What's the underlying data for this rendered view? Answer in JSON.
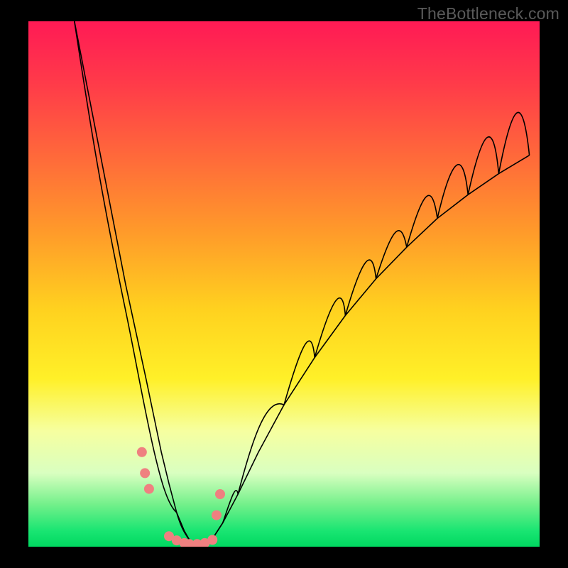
{
  "watermark": "TheBottleneck.com",
  "chart_data": {
    "type": "line",
    "title": "",
    "xlabel": "",
    "ylabel": "",
    "xlim": [
      0,
      100
    ],
    "ylim": [
      0,
      100
    ],
    "grid": false,
    "series": [
      {
        "name": "bottleneck-curve",
        "x": [
          9,
          11,
          13,
          15,
          17,
          19,
          21,
          23,
          24.5,
          26,
          27.5,
          29,
          30.5,
          31.5,
          33,
          34.5,
          36,
          38,
          41,
          45,
          50,
          56,
          62,
          68,
          74,
          80,
          86,
          92,
          98
        ],
        "values": [
          100,
          90,
          80,
          70,
          60,
          50,
          41,
          32,
          25,
          18,
          12,
          6.5,
          3,
          1.3,
          0.5,
          0.5,
          1.5,
          4.5,
          10,
          18,
          27,
          36,
          44,
          51,
          57,
          62.5,
          67,
          71,
          74.5
        ]
      }
    ],
    "markers": {
      "name": "highlight-points",
      "x": [
        22.2,
        22.8,
        23.6,
        27.5,
        29,
        30.5,
        31.5,
        33,
        34.5,
        36,
        36.8,
        37.5
      ],
      "values": [
        18,
        14,
        11,
        2,
        1.2,
        0.7,
        0.5,
        0.5,
        0.7,
        1.3,
        6,
        10
      ]
    },
    "background_gradient": {
      "top": "#ff1a55",
      "mid": "#fff028",
      "bottom": "#00d860"
    }
  }
}
